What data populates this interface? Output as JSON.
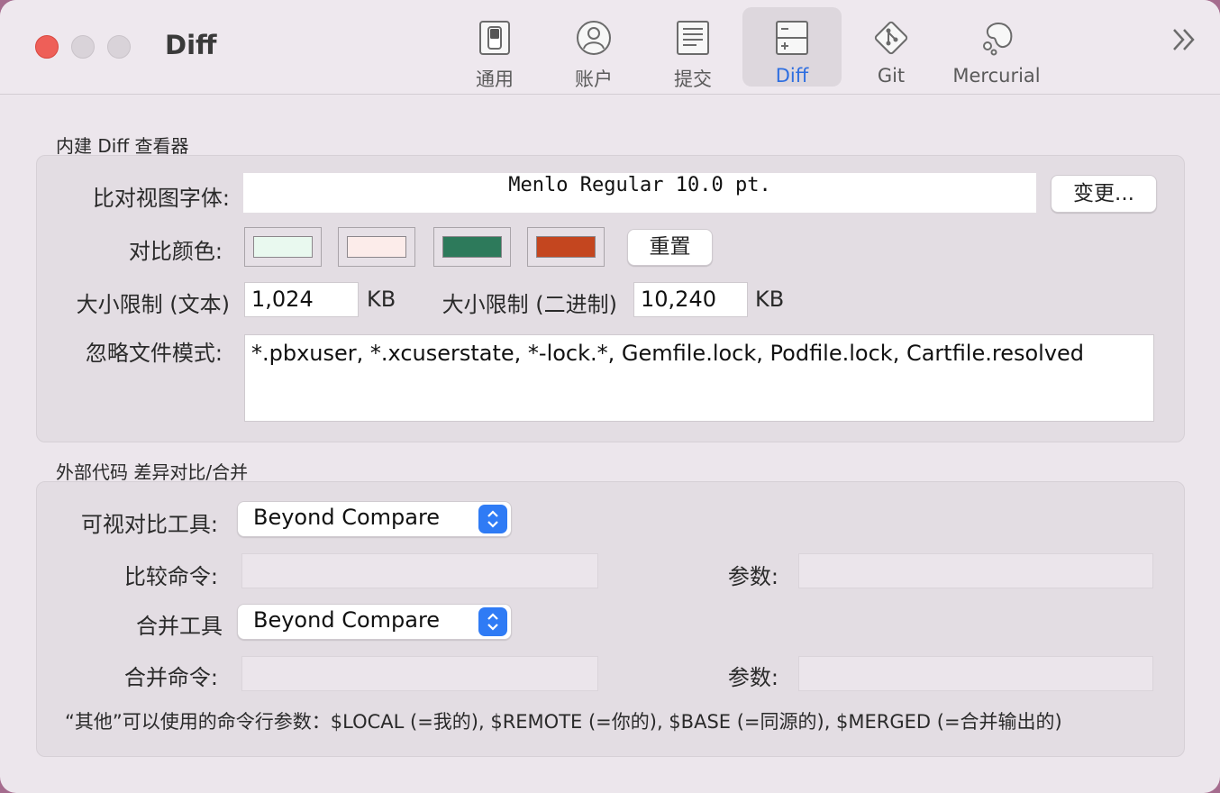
{
  "window": {
    "title": "Diff"
  },
  "toolbar": {
    "tabs": [
      {
        "label": "通用",
        "icon": "switch-icon"
      },
      {
        "label": "账户",
        "icon": "person-icon"
      },
      {
        "label": "提交",
        "icon": "document-icon"
      },
      {
        "label": "Diff",
        "icon": "diff-icon",
        "active": true
      },
      {
        "label": "Git",
        "icon": "git-icon"
      },
      {
        "label": "Mercurial",
        "icon": "mercurial-icon"
      }
    ],
    "more_icon": "double-chevron-right-icon"
  },
  "builtin": {
    "section_title": "内建 Diff 查看器",
    "font_label": "比对视图字体:",
    "font_value": "Menlo Regular 10.0 pt.",
    "change_button": "变更...",
    "color_label": "对比颜色:",
    "colors": [
      "#e9f9ef",
      "#fcecea",
      "#2d7a5b",
      "#c4461f"
    ],
    "reset_button": "重置",
    "size_text_label": "大小限制 (文本)",
    "size_text_value": "1,024",
    "size_text_unit": "KB",
    "size_binary_label": "大小限制 (二进制)",
    "size_binary_value": "10,240",
    "size_binary_unit": "KB",
    "ignore_label": "忽略文件模式:",
    "ignore_value": "*.pbxuser, *.xcuserstate, *-lock.*, Gemfile.lock, Podfile.lock, Cartfile.resolved"
  },
  "external": {
    "section_title": "外部代码 差异对比/合并",
    "visual_tool_label": "可视对比工具:",
    "visual_tool_value": "Beyond Compare",
    "compare_cmd_label": "比较命令:",
    "compare_args_label": "参数:",
    "merge_tool_label": "合并工具",
    "merge_tool_value": "Beyond Compare",
    "merge_cmd_label": "合并命令:",
    "merge_args_label": "参数:",
    "note": "“其他”可以使用的命令行参数：$LOCAL (=我的), $REMOTE (=你的), $BASE (=同源的), $MERGED (=合并输出的)"
  },
  "colors": {
    "accent": "#2f6fe0",
    "stepper": "#2f7bf5",
    "close": "#ee5f58"
  }
}
